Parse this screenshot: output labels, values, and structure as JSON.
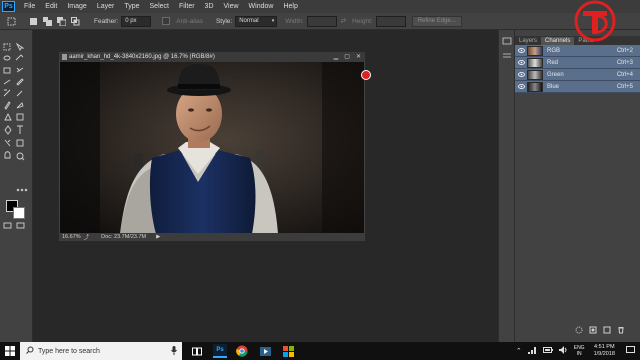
{
  "menu": {
    "app_logo": "Ps",
    "items": [
      "File",
      "Edit",
      "Image",
      "Layer",
      "Type",
      "Select",
      "Filter",
      "3D",
      "View",
      "Window",
      "Help"
    ]
  },
  "options_bar": {
    "feather_label": "Feather:",
    "feather_value": "0 px",
    "anti_alias_label": "Anti-alias",
    "style_label": "Style:",
    "style_value": "Normal",
    "width_label": "Width:",
    "height_label": "Height:",
    "refine_edge_label": "Refine Edge..."
  },
  "document": {
    "title": "aamir_khan_hd_4k-3840x2160.jpg @ 16.7% (RGB/8#)",
    "zoom": "16.67%",
    "doc_size": "Doc: 23.7M/23.7M"
  },
  "panels": {
    "tabs": [
      "Layers",
      "Channels",
      "Paths"
    ],
    "active_tab": "Channels",
    "channels": [
      {
        "name": "RGB",
        "shortcut": "Ctrl+2"
      },
      {
        "name": "Red",
        "shortcut": "Ctrl+3"
      },
      {
        "name": "Green",
        "shortcut": "Ctrl+4"
      },
      {
        "name": "Blue",
        "shortcut": "Ctrl+5"
      }
    ]
  },
  "taskbar": {
    "search_placeholder": "Type here to search",
    "lang_line1": "ENG",
    "lang_line2": "IN",
    "time": "4:51 PM",
    "date": "1/9/2018"
  },
  "colors": {
    "brand_red": "#e0201f",
    "selection_blue": "#5a6f8c",
    "ps_blue": "#31a8ff"
  }
}
